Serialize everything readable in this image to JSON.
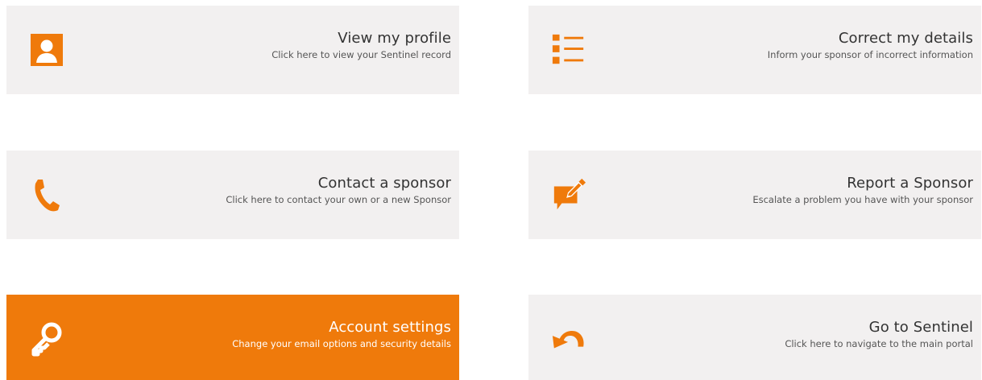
{
  "colors": {
    "accent": "#ef7a0b",
    "tile_bg": "#f2f0f0",
    "text": "#333333"
  },
  "tiles": [
    {
      "title": "View my profile",
      "subtitle": "Click here to view your Sentinel record",
      "icon": "profile-icon",
      "active": false
    },
    {
      "title": "Correct my details",
      "subtitle": "Inform your sponsor of incorrect information",
      "icon": "list-icon",
      "active": false
    },
    {
      "title": "Contact a sponsor",
      "subtitle": "Click here to contact your own or a new Sponsor",
      "icon": "phone-icon",
      "active": false
    },
    {
      "title": "Report a Sponsor",
      "subtitle": "Escalate a problem you have with your sponsor",
      "icon": "report-icon",
      "active": false
    },
    {
      "title": "Account settings",
      "subtitle": "Change your email options and security details",
      "icon": "key-icon",
      "active": true
    },
    {
      "title": "Go to Sentinel",
      "subtitle": "Click here to navigate to the main portal",
      "icon": "undo-arrow-icon",
      "active": false
    }
  ]
}
